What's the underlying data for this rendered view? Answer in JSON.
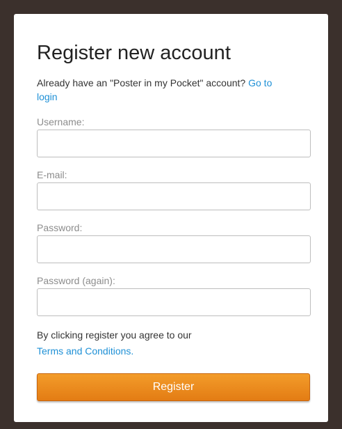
{
  "form": {
    "title": "Register new account",
    "intro_text": "Already have an \"Poster in my Pocket\" account?",
    "login_link": "Go to login",
    "fields": [
      {
        "label": "Username:",
        "value": "",
        "placeholder": ""
      },
      {
        "label": "E-mail:",
        "value": "",
        "placeholder": ""
      },
      {
        "label": "Password:",
        "value": "",
        "placeholder": ""
      },
      {
        "label": "Password (again):",
        "value": "",
        "placeholder": ""
      }
    ],
    "terms_text": "By clicking register you agree to our",
    "terms_link": "Terms and Conditions.",
    "register_label": "Register"
  },
  "colors": {
    "background": "#3b302c",
    "panel": "#ffffff",
    "link": "#1e90d6",
    "button": "#e8861c",
    "label": "#8c8c8c"
  }
}
